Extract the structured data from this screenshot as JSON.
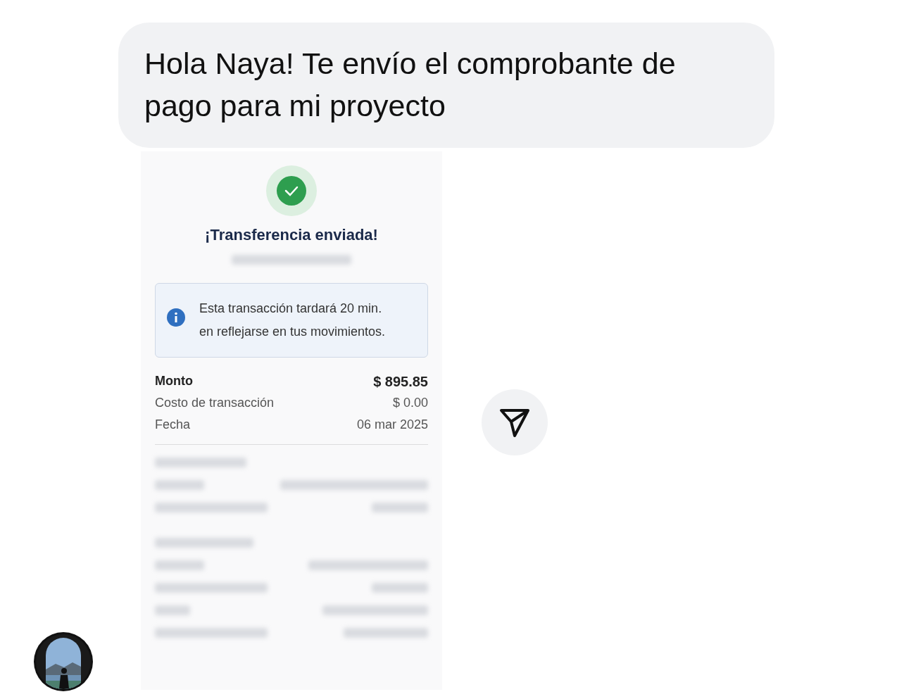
{
  "message": {
    "text": "Hola Naya! Te envío el comprobante de pago para mi proyecto"
  },
  "receipt": {
    "title": "¡Transferencia enviada!",
    "info": "Esta transacción tardará 20 min. en reflejarse en tus movimientos.",
    "rows": [
      {
        "label": "Monto",
        "value": "$ 895.85",
        "emphasis": true
      },
      {
        "label": "Costo de transacción",
        "value": "$ 0.00",
        "emphasis": false
      },
      {
        "label": "Fecha",
        "value": "06 mar 2025",
        "emphasis": false
      }
    ]
  }
}
